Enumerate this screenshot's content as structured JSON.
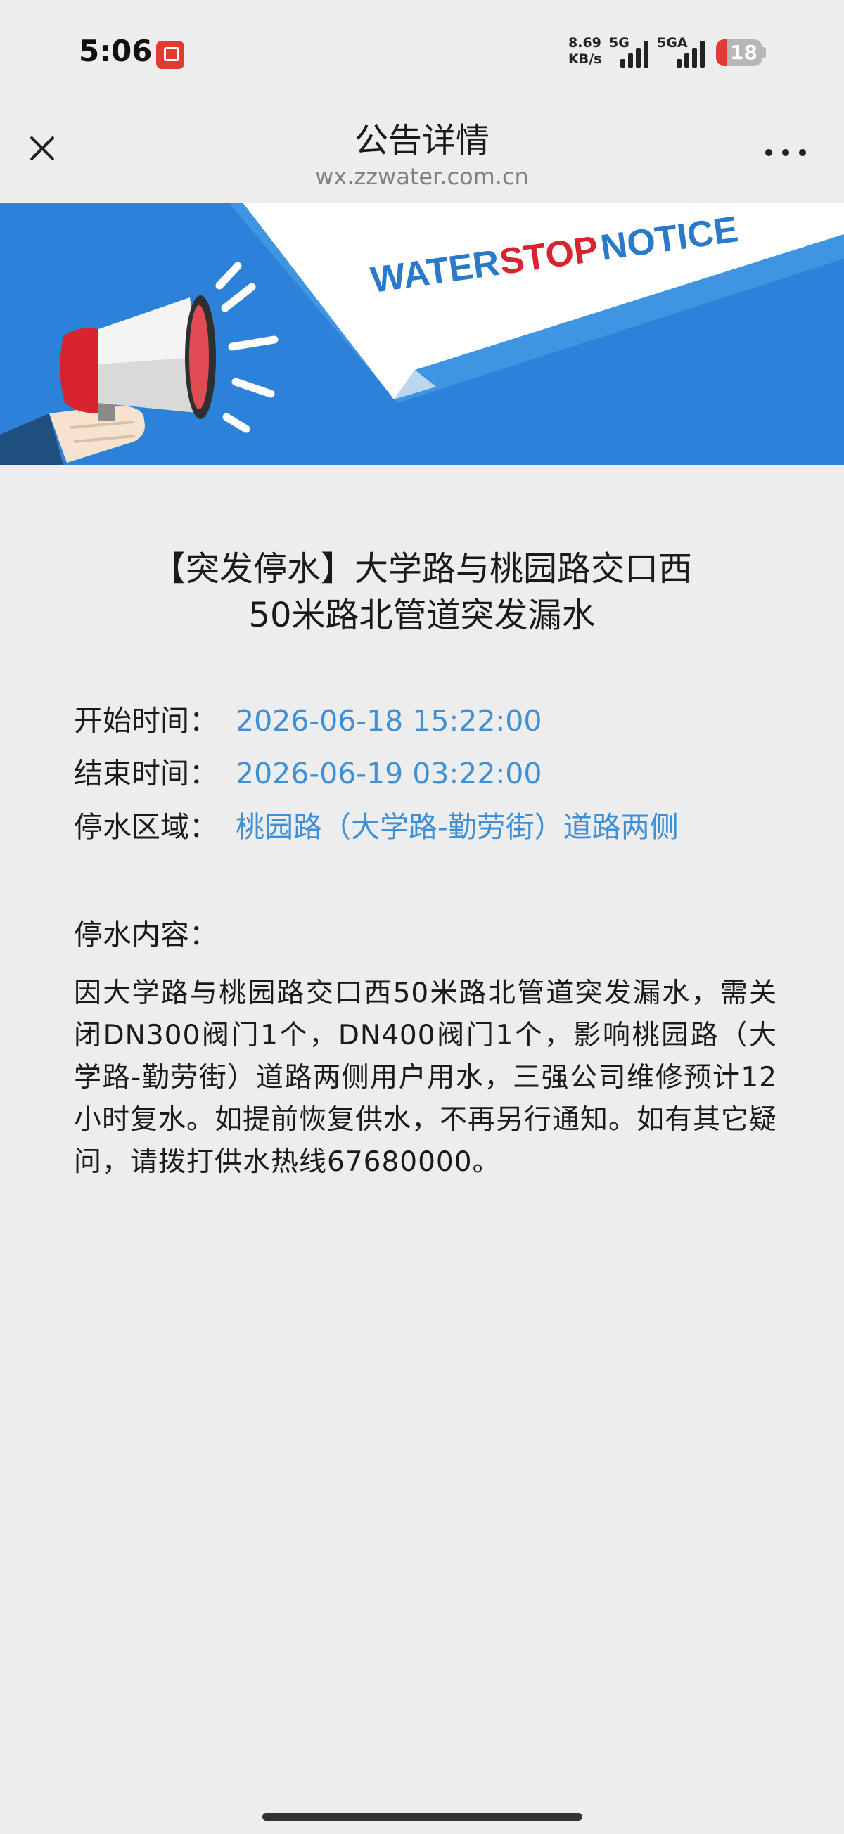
{
  "status_bar": {
    "time": "5:06",
    "net_speed_value": "8.69",
    "net_speed_unit": "KB/s",
    "net_type_1": "5G",
    "net_type_2": "5GA",
    "battery_level": "18",
    "battery_color": "#e53935"
  },
  "nav": {
    "title": "公告详情",
    "subtitle": "wx.zzwater.com.cn",
    "close_icon": "close-icon",
    "more_icon": "more-icon"
  },
  "banner": {
    "word_1": "WATER",
    "word_2": "STOP",
    "word_3": "NOTICE",
    "accent_blue": "#2b82d8",
    "accent_red": "#d9232e"
  },
  "article": {
    "title_line_1": "【突发停水】大学路与桃园路交口西",
    "title_line_2": "50米路北管道突发漏水",
    "start_label": "开始时间：",
    "start_value": "2026-06-18 15:22:00",
    "end_label": "结束时间：",
    "end_value": "2026-06-19 03:22:00",
    "area_label": "停水区域：",
    "area_value": "桃园路（大学路-勤劳街）道路两侧",
    "content_heading": "停水内容：",
    "content_body": "因大学路与桃园路交口西50米路北管道突发漏水，需关闭DN300阀门1个，DN400阀门1个，影响桃园路（大学路-勤劳街）道路两侧用户用水，三强公司维修预计12小时复水。如提前恢复供水，不再另行通知。如有其它疑问，请拨打供水热线67680000。",
    "value_color": "#3d8fd6"
  }
}
